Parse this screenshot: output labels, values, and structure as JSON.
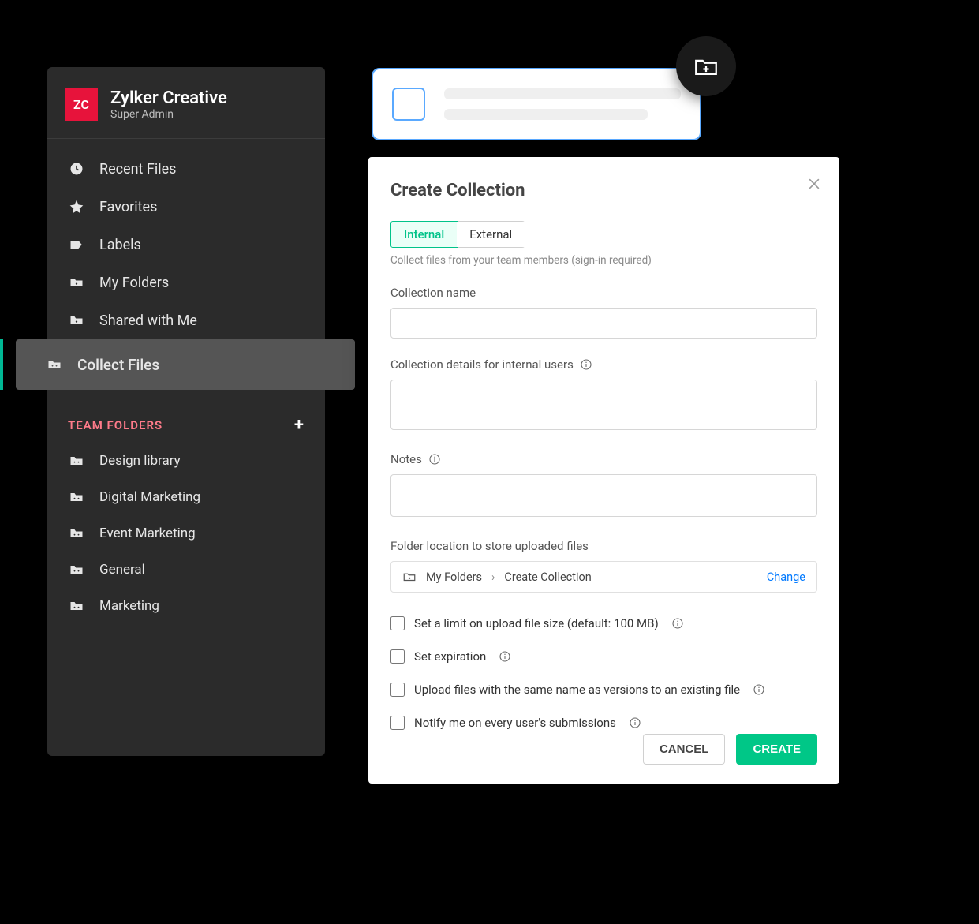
{
  "sidebar": {
    "avatar_initials": "ZC",
    "org_name": "Zylker Creative",
    "role": "Super Admin",
    "nav": [
      {
        "label": "Recent Files"
      },
      {
        "label": "Favorites"
      },
      {
        "label": "Labels"
      },
      {
        "label": "My Folders"
      },
      {
        "label": "Shared with Me"
      },
      {
        "label": "Collect Files"
      }
    ],
    "team_section": "TEAM FOLDERS",
    "team_folders": [
      {
        "label": "Design library"
      },
      {
        "label": "Digital Marketing"
      },
      {
        "label": "Event Marketing"
      },
      {
        "label": "General"
      },
      {
        "label": "Marketing"
      }
    ]
  },
  "modal": {
    "title": "Create Collection",
    "tabs": {
      "internal": "Internal",
      "external": "External"
    },
    "hint": "Collect files from your team members (sign-in required)",
    "name_label": "Collection name",
    "details_label": "Collection details for internal users",
    "notes_label": "Notes",
    "location_label": "Folder location to store uploaded files",
    "path": {
      "root": "My Folders",
      "current": "Create Collection",
      "change": "Change"
    },
    "checks": {
      "limit": "Set a limit on upload file size (default: 100 MB)",
      "expire": "Set expiration",
      "versions": "Upload files with the same name as versions to an existing file",
      "notify": "Notify me on every user's submissions"
    },
    "actions": {
      "cancel": "CANCEL",
      "create": "CREATE"
    }
  }
}
